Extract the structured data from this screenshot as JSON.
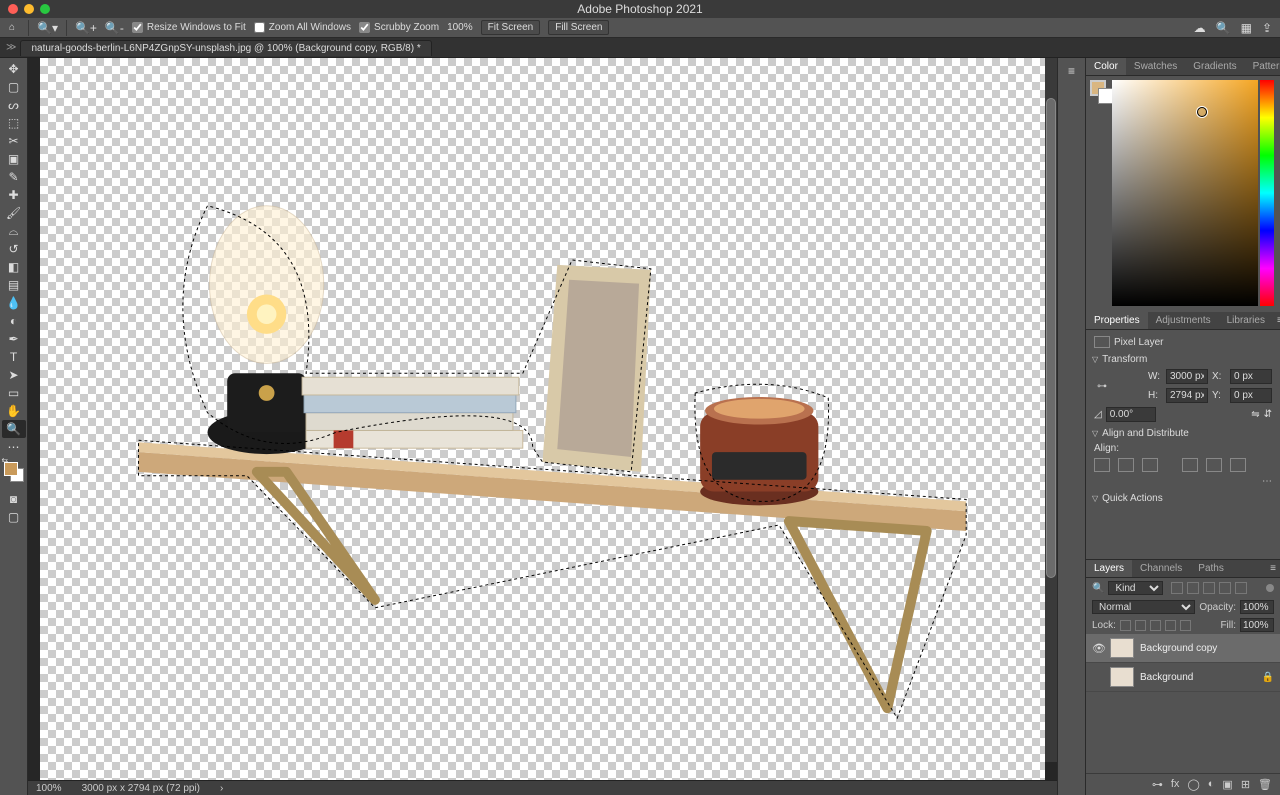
{
  "app_title": "Adobe Photoshop 2021",
  "options": {
    "zoom_value": "100%",
    "resize_windows": "Resize Windows to Fit",
    "zoom_all": "Zoom All Windows",
    "scrubby": "Scrubby Zoom",
    "fit_screen": "Fit Screen",
    "fill_screen": "Fill Screen"
  },
  "doc_tab": "natural-goods-berlin-L6NP4ZGnpSY-unsplash.jpg @ 100% (Background copy, RGB/8) *",
  "status": {
    "zoom": "100%",
    "dims": "3000 px x 2794 px (72 ppi)"
  },
  "right_tabs": {
    "color": "Color",
    "swatches": "Swatches",
    "gradients": "Gradients",
    "patterns": "Patterns",
    "properties": "Properties",
    "adjustments": "Adjustments",
    "libraries": "Libraries",
    "layers": "Layers",
    "channels": "Channels",
    "paths": "Paths"
  },
  "properties": {
    "layer_type": "Pixel Layer",
    "transform_header": "Transform",
    "w_label": "W:",
    "w_value": "3000 px",
    "h_label": "H:",
    "h_value": "2794 px",
    "x_label": "X:",
    "x_value": "0 px",
    "y_label": "Y:",
    "y_value": "0 px",
    "angle_value": "0.00°",
    "align_header": "Align and Distribute",
    "align_label": "Align:",
    "quick_header": "Quick Actions"
  },
  "layers": {
    "filter_label": "Kind",
    "blend_mode": "Normal",
    "opacity_label": "Opacity:",
    "opacity_value": "100%",
    "lock_label": "Lock:",
    "fill_label": "Fill:",
    "fill_value": "100%",
    "items": [
      {
        "name": "Background copy",
        "visible": true,
        "selected": true,
        "locked": false
      },
      {
        "name": "Background",
        "visible": false,
        "selected": false,
        "locked": true
      }
    ]
  }
}
